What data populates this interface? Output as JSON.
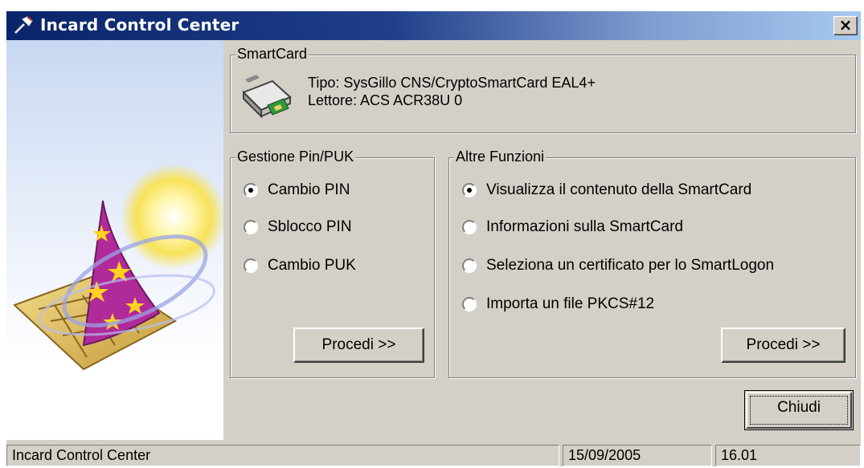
{
  "window": {
    "title": "Incard Control Center",
    "close_glyph": "×"
  },
  "smartcard": {
    "legend": "SmartCard",
    "tipo": "Tipo: SysGillo CNS/CryptoSmartCard EAL4+",
    "lettore": "Lettore: ACS ACR38U 0",
    "icon": "card-reader-icon"
  },
  "pin_group": {
    "legend": "Gestione Pin/PUK",
    "options": [
      {
        "label": "Cambio PIN",
        "checked": true
      },
      {
        "label": "Sblocco PIN",
        "checked": false
      },
      {
        "label": "Cambio PUK",
        "checked": false
      }
    ],
    "proceed_label": "Procedi >>"
  },
  "other_group": {
    "legend": "Altre Funzioni",
    "options": [
      {
        "label": "Visualizza il contenuto della SmartCard",
        "checked": true
      },
      {
        "label": "Informazioni sulla SmartCard",
        "checked": false
      },
      {
        "label": "Seleziona un certificato per lo SmartLogon",
        "checked": false
      },
      {
        "label": "Importa un file PKCS#12",
        "checked": false
      }
    ],
    "proceed_label": "Procedi >>"
  },
  "close_button_label": "Chiudi",
  "statusbar": {
    "app": "Incard Control Center",
    "date": "15/09/2005",
    "time": "16.01"
  },
  "colors": {
    "titlebar_start": "#0a246a",
    "titlebar_end": "#a6caf0",
    "face": "#d4d0c8"
  },
  "icons": {
    "title": "wand-icon",
    "close": "close-icon",
    "side_art": "wizard-hat-smartcard-illustration"
  }
}
